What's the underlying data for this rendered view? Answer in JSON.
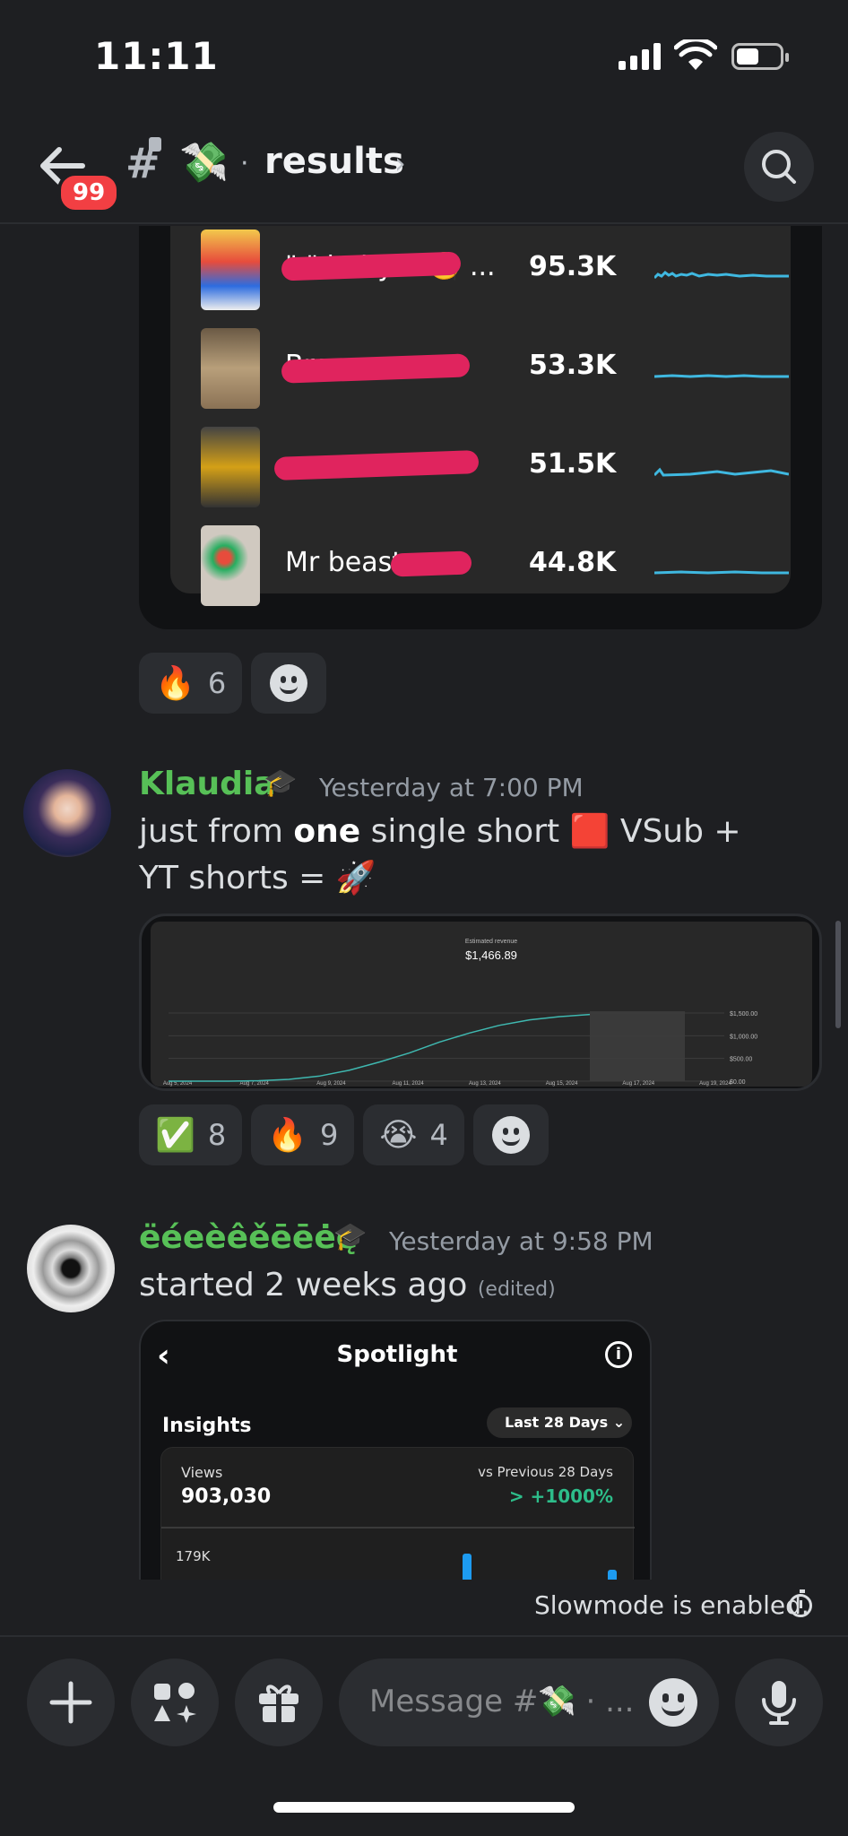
{
  "status_bar": {
    "time": "11:11"
  },
  "header": {
    "unread_badge": "99",
    "channel_emoji": "💸",
    "channel_sep": "·",
    "channel_name": "results",
    "chevron": "›"
  },
  "embed_top": {
    "rows": [
      {
        "title": "\"  \"  baby 2 🧐 ...",
        "views": "95.3K"
      },
      {
        "title": "Bro g  ...",
        "views": "53.3K"
      },
      {
        "title": "   ...",
        "views": "51.5K"
      },
      {
        "title": "Mr beast  ...",
        "views": "44.8K"
      }
    ],
    "reactions": [
      {
        "emoji": "🔥",
        "count": "6"
      }
    ]
  },
  "messages": [
    {
      "author": "Klaudia",
      "role_icon": "🎓",
      "timestamp": "Yesterday at 7:00 PM",
      "text_pre": "just from ",
      "text_bold": "one",
      "text_post": " single short 🟥 VSub + YT shorts = 🚀",
      "reactions": [
        {
          "emoji": "✅",
          "count": "8"
        },
        {
          "emoji": "🔥",
          "count": "9"
        },
        {
          "emoji": "😭",
          "count": "4"
        }
      ]
    },
    {
      "author": "ëéeèêěēēėę",
      "role_icon": "🎓",
      "timestamp": "Yesterday at 9:58 PM",
      "text": "started 2 weeks ago",
      "edited": "(edited)"
    }
  ],
  "chart_data": {
    "type": "line",
    "title": "Estimated revenue",
    "headline_value": "$1,466.89",
    "categories": [
      "Aug 5, 2024",
      "Aug 7, 2024",
      "Aug 9, 2024",
      "Aug 11, 2024",
      "Aug 13, 2024",
      "Aug 15, 2024",
      "Aug 17, 2024",
      "Aug 19, 2024"
    ],
    "yticks": [
      "$1,500.00",
      "$1,000.00",
      "$500.00",
      "$0.00"
    ],
    "ylim": [
      0,
      1500
    ],
    "series": [
      {
        "x": [
          0,
          1,
          2,
          3,
          4,
          5,
          6,
          7,
          8,
          9,
          10,
          11,
          12,
          13,
          14
        ],
        "values": [
          0,
          0,
          0,
          10,
          40,
          110,
          240,
          420,
          620,
          860,
          1060,
          1230,
          1350,
          1420,
          1466.89
        ]
      }
    ],
    "line_color": "#3fb8b0"
  },
  "spotlight": {
    "back": "‹",
    "title": "Spotlight",
    "info": "i",
    "insights_label": "Insights",
    "range": "Last 28 Days",
    "views_label": "Views",
    "views_value": "903,030",
    "compare_label": "vs Previous 28 Days",
    "compare_value": "> +1000%",
    "axis_top": "179K"
  },
  "slowmode": {
    "text": "Slowmode is enabled."
  },
  "composer": {
    "placeholder": "Message #💸 · ..."
  },
  "colors": {
    "bg": "#1e1f22",
    "author": "#57c057",
    "accent_red": "#f23f43",
    "redaction": "#e0245e"
  },
  "icons": [
    "back-arrow-icon",
    "hash-lock-icon",
    "search-icon",
    "smiley-add-reaction-icon",
    "timer-icon",
    "plus-icon",
    "apps-icon",
    "gift-icon",
    "microphone-icon",
    "info-icon",
    "chevron-down-icon"
  ]
}
